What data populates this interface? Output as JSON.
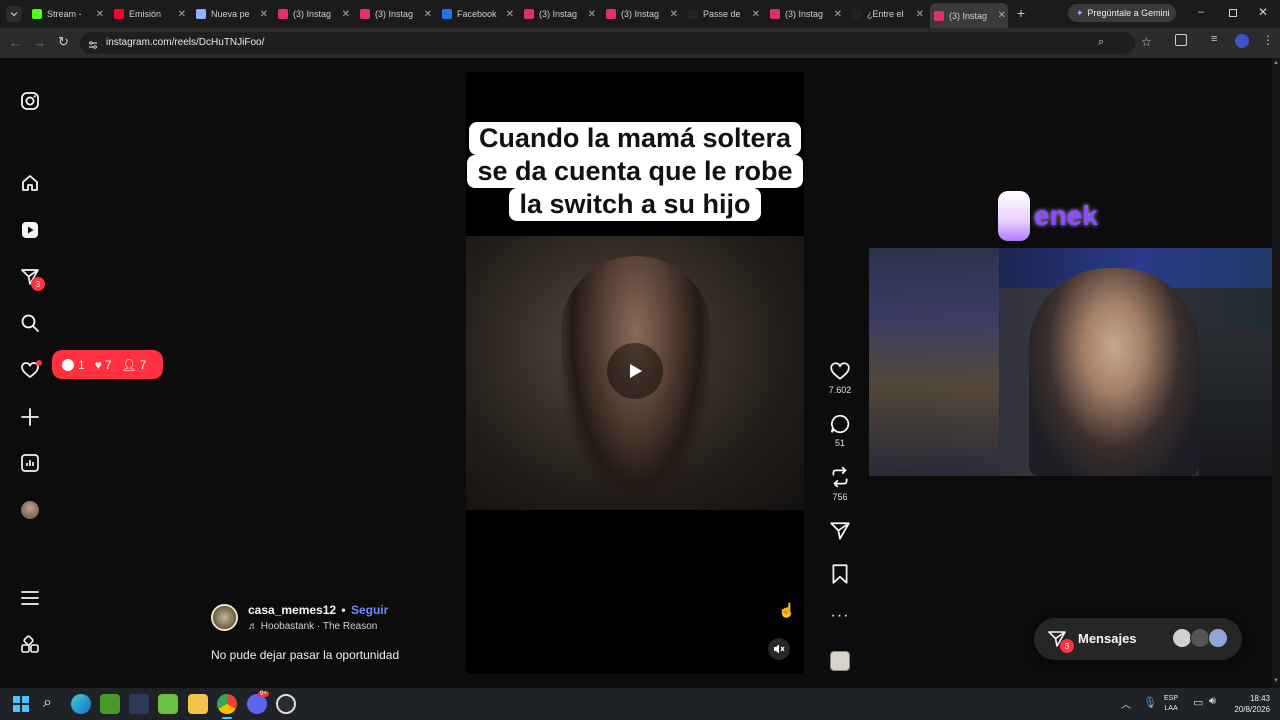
{
  "browser": {
    "tabs": [
      {
        "title": "Stream -",
        "color": "#53fc18"
      },
      {
        "title": "Emisión",
        "color": "#ff0033"
      },
      {
        "title": "Nueva pe",
        "color": "#8ab4f8"
      },
      {
        "title": "(3) Instag",
        "color": "#e1306c"
      },
      {
        "title": "(3) Instag",
        "color": "#e1306c"
      },
      {
        "title": "Facebook",
        "color": "#1877f2"
      },
      {
        "title": "(3) Instag",
        "color": "#e1306c"
      },
      {
        "title": "(3) Instag",
        "color": "#e1306c"
      },
      {
        "title": "Passe de",
        "color": "#222222"
      },
      {
        "title": "(3) Instag",
        "color": "#e1306c"
      },
      {
        "title": "¿Entre el",
        "color": "#222222"
      },
      {
        "title": "(3) Instag",
        "color": "#e1306c",
        "active": true
      }
    ],
    "gemini_label": "Pregúntale a Gemini",
    "url": "instagram.com/reels/DcHuTNJiFoo/"
  },
  "sidebar": {
    "messages_badge": "3",
    "notifications": {
      "comments": "1",
      "likes": "7",
      "follows": "7"
    }
  },
  "reel": {
    "caption_lines": [
      "Cuando la mamá soltera",
      "se da cuenta que le robe",
      "la switch a su hijo"
    ],
    "author": "casa_memes12",
    "separator": "•",
    "follow_label": "Seguir",
    "music": "Hoobastank · The Reason",
    "description": "No pude dejar pasar la oportunidad",
    "likes": "7.602",
    "comments": "51",
    "reposts": "756"
  },
  "overlay": {
    "brand_text": "enek"
  },
  "messages": {
    "label": "Mensajes",
    "badge": "3"
  },
  "taskbar": {
    "lang_top": "ESP",
    "lang_bottom": "LAA",
    "time": "18:43",
    "date": "20/8/2026",
    "discord_badge": "9+"
  }
}
